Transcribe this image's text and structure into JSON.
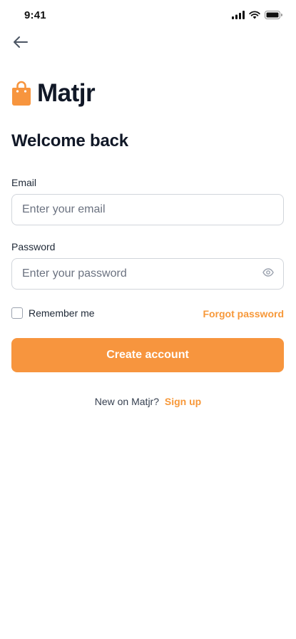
{
  "status_bar": {
    "time": "9:41"
  },
  "header": {
    "back_icon": "arrow-left-icon"
  },
  "brand": {
    "name": "Matjr",
    "logo_icon": "shopping-bag-icon",
    "accent": "#F7953E"
  },
  "page": {
    "title": "Welcome back"
  },
  "form": {
    "email": {
      "label": "Email",
      "placeholder": "Enter your email",
      "value": ""
    },
    "password": {
      "label": "Password",
      "placeholder": "Enter your password",
      "value": "",
      "toggle_icon": "eye-icon"
    },
    "remember": {
      "label": "Remember me",
      "checked": false
    },
    "forgot_label": "Forgot password",
    "submit_label": "Create account"
  },
  "footer": {
    "prompt": "New on Matjr?",
    "link_label": "Sign up"
  }
}
